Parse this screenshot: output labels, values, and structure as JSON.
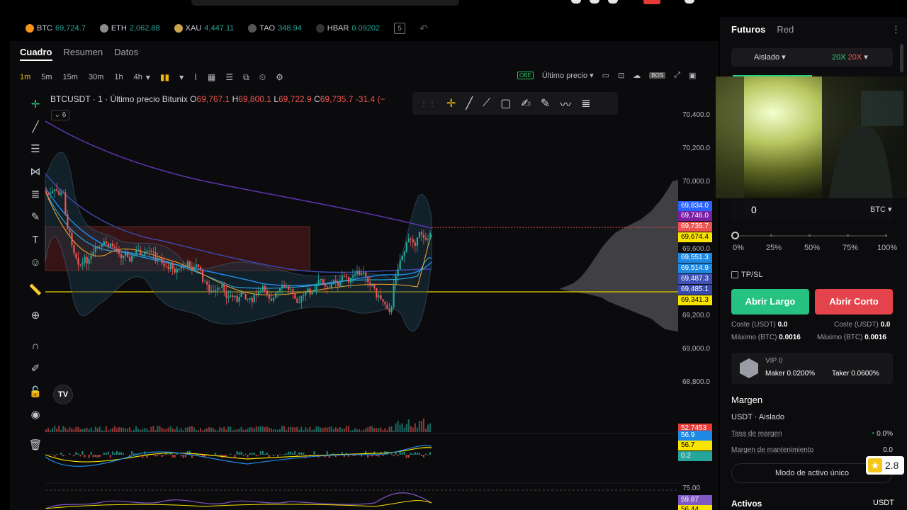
{
  "tickers": [
    {
      "symbol": "BTC",
      "price": "69,724.7",
      "color": "#f7931a"
    },
    {
      "symbol": "ETH",
      "price": "2,062.88",
      "color": "#8c8c8c"
    },
    {
      "symbol": "XAU",
      "price": "4,447.11",
      "color": "#c9a64b"
    },
    {
      "symbol": "TAO",
      "price": "348.94",
      "color": "#555555"
    },
    {
      "symbol": "HBAR",
      "price": "0.09202",
      "color": "#333333"
    }
  ],
  "tabs": [
    "Cuadro",
    "Resumen",
    "Datos"
  ],
  "timeframes": [
    "1m",
    "5m",
    "15m",
    "30m",
    "1h",
    "4h"
  ],
  "toolbar": {
    "price_type": "Último precio",
    "obe": "OBE",
    "bos": "BOS"
  },
  "legend": {
    "title": "BTCUSDT · 1 · Último precio Bitunix",
    "o_label": "O",
    "o": "69,767.1",
    "h_label": "H",
    "h": "69,800.1",
    "l_label": "L",
    "l": "69,722.9",
    "c_label": "C",
    "c": "69,735.7",
    "chg": "-31.4 (−",
    "count": "6"
  },
  "price_axis": [
    "70,400.0",
    "70,200.0",
    "70,000.0",
    "69,600.0",
    "69,200.0",
    "69,000.0",
    "68,800.0",
    "75.00"
  ],
  "price_tags": [
    {
      "v": "69,834.0",
      "bg": "#2962ff"
    },
    {
      "v": "69,746.0",
      "bg": "#7b1fa2"
    },
    {
      "v": "69,735.7",
      "bg": "#ef5350"
    },
    {
      "v": "69,674.4",
      "bg": "#f9e400",
      "fg": "#000"
    },
    {
      "v": "69,551.3",
      "bg": "#1e88e5"
    },
    {
      "v": "69,514.9",
      "bg": "#1e88e5"
    },
    {
      "v": "69,487.3",
      "bg": "#3f51b5"
    },
    {
      "v": "69,485.1",
      "bg": "#3949ab"
    },
    {
      "v": "69,341.3",
      "bg": "#f9e400",
      "fg": "#000"
    }
  ],
  "indicator_tags": [
    {
      "v": "52.7453",
      "bg": "#e53935"
    },
    {
      "v": "56.9",
      "bg": "#1e88e5"
    },
    {
      "v": "56.7",
      "bg": "#f9e400",
      "fg": "#000"
    },
    {
      "v": "0.2",
      "bg": "#26a69a"
    },
    {
      "v": "59.87",
      "bg": "#7e57c2"
    },
    {
      "v": "56.44",
      "bg": "#f9e400",
      "fg": "#000"
    }
  ],
  "tv_logo": "TV",
  "trade": {
    "tab_futures": "Futuros",
    "tab_net": "Red",
    "margin_mode": "Aislado",
    "lev_long": "20X",
    "lev_short": "20X",
    "qty": "0",
    "qty_unit": "BTC",
    "pcts": [
      "0%",
      "25%",
      "50%",
      "75%",
      "100%"
    ],
    "tpsl": "TP/SL",
    "btn_long": "Abrir Largo",
    "btn_short": "Abrir Corto",
    "cost_label": "Coste (USDT)",
    "cost_long": "0.0",
    "cost_short": "0.0",
    "max_label": "Máximo (BTC)",
    "max_long": "0.0016",
    "max_short": "0.0016",
    "vip": "VIP 0",
    "maker": "Maker 0.0200%",
    "taker": "Taker 0.0600%",
    "margin_title": "Margen",
    "margin_sub": "USDT · Aislado",
    "margin_rate_label": "Tasa de margen",
    "margin_rate": "0.0%",
    "maint_label": "Margen de mantenimiento",
    "maint": "0.0",
    "mode_btn": "Modo de activo único",
    "assets": "Activos",
    "assets_unit": "USDT"
  },
  "rating": "2.8",
  "colors": {
    "up": "#26a69a",
    "down": "#ef5350",
    "ma_purple": "#5e35b1",
    "ma_blue": "#1e88e5",
    "support": "#c8b400"
  }
}
